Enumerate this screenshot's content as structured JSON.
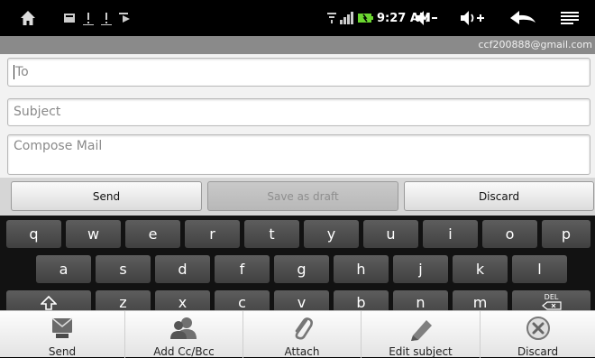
{
  "status_bar": {
    "time": "9:27 AM",
    "icons": [
      "home-icon",
      "notification-icon",
      "warning-icon",
      "warning-icon",
      "play-store-icon",
      "wifi-icon",
      "signal-icon",
      "battery-icon",
      "volume-down-icon",
      "volume-up-icon",
      "back-icon",
      "menu-icon"
    ]
  },
  "account": {
    "email": "ccf200888@gmail.com"
  },
  "compose": {
    "to_placeholder": "To",
    "subject_placeholder": "Subject",
    "body_placeholder": "Compose Mail"
  },
  "actions": {
    "send": "Send",
    "save_draft": "Save as draft",
    "discard": "Discard"
  },
  "keyboard": {
    "row1": [
      "q",
      "w",
      "e",
      "r",
      "t",
      "y",
      "u",
      "i",
      "o",
      "p"
    ],
    "row2": [
      "a",
      "s",
      "d",
      "f",
      "g",
      "h",
      "j",
      "k",
      "l"
    ],
    "row3": [
      "z",
      "x",
      "c",
      "v",
      "b",
      "n",
      "m"
    ],
    "del_label": "DEL"
  },
  "menu": {
    "send": "Send",
    "add_cc_bcc": "Add Cc/Bcc",
    "attach": "Attach",
    "edit_subject": "Edit subject",
    "discard": "Discard"
  },
  "colors": {
    "account_bar": "#8a8a8a",
    "keyboard_bg": "#121212",
    "key": "#4e4e4e"
  }
}
